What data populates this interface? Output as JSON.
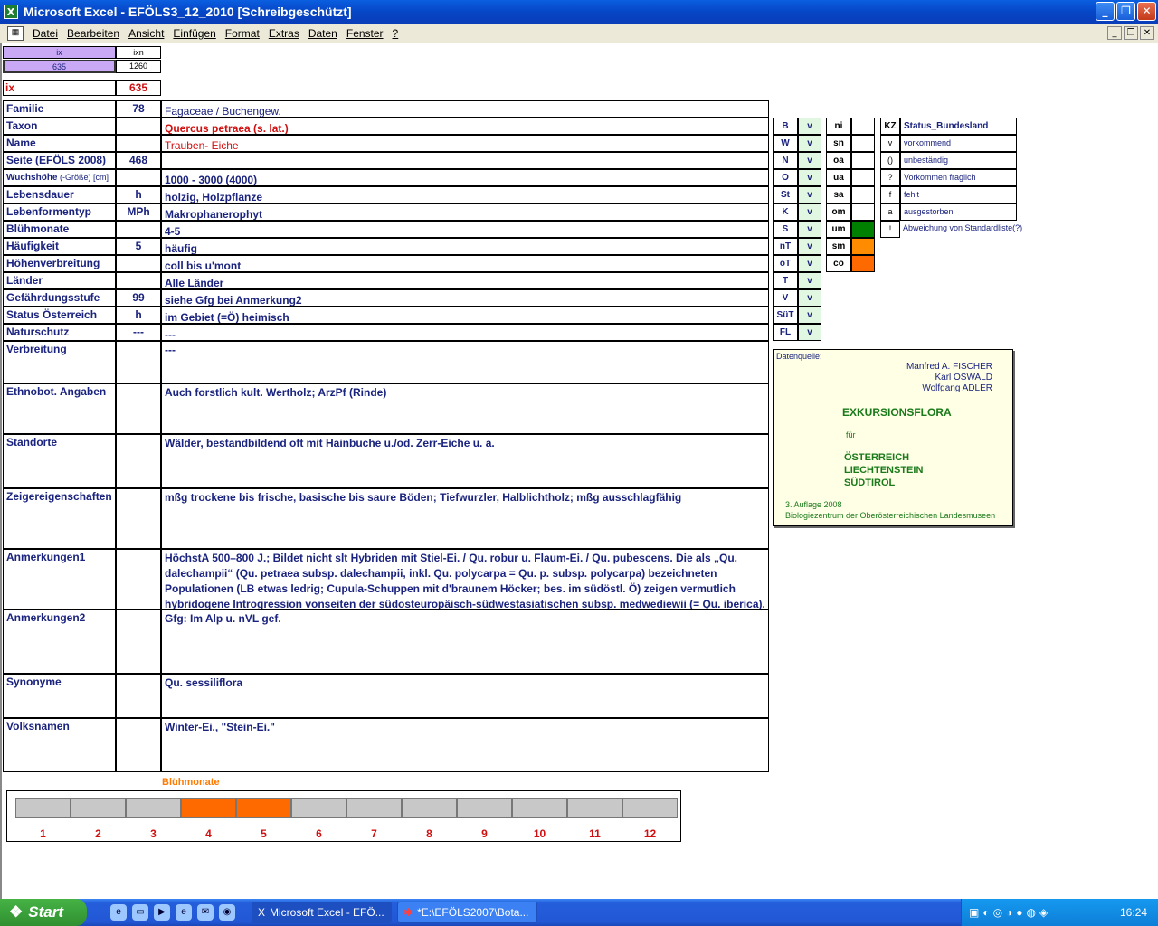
{
  "window": {
    "title": "Microsoft Excel - EFÖLS3_12_2010  [Schreibgeschützt]",
    "icon": "excel-icon"
  },
  "menu": [
    "Datei",
    "Bearbeiten",
    "Ansicht",
    "Einfügen",
    "Format",
    "Extras",
    "Daten",
    "Fenster",
    "?"
  ],
  "top": {
    "ix_label": "ix",
    "ixn_label": "ixn",
    "ix_value": "635",
    "ixn_value": "1260",
    "ix_big_label": "ix",
    "ix_big_value": "635"
  },
  "rows": [
    {
      "label": "Familie",
      "num": "78",
      "text": "Fagaceae  /  Buchengew."
    },
    {
      "label": "Taxon",
      "num": "",
      "text": "Quercus petraea (s. lat.)"
    },
    {
      "label": "Name",
      "num": "",
      "text": "Trauben- Eiche"
    },
    {
      "label": "Seite (EFÖLS 2008)",
      "num": "468",
      "text": ""
    },
    {
      "label": "Wuchshöhe",
      "label_extra": "(-Größe) [cm]",
      "num": "",
      "text": "1000 - 3000 (4000)"
    },
    {
      "label": "Lebensdauer",
      "num": "h",
      "text": "holzig, Holzpflanze"
    },
    {
      "label": "Lebenformentyp",
      "num": "MPh",
      "text": "Makrophanerophyt"
    },
    {
      "label": "Blühmonate",
      "num": "",
      "text": "4-5"
    },
    {
      "label": "Häufigkeit",
      "num": "5",
      "text": "häufig"
    },
    {
      "label": "Höhenverbreitung",
      "num": "",
      "text": "coll bis u'mont"
    },
    {
      "label": "Länder",
      "num": "",
      "text": "Alle Länder"
    },
    {
      "label": "Gefährdungsstufe",
      "num": "99",
      "text": "siehe Gfg bei Anmerkung2"
    },
    {
      "label": "Status Österreich",
      "num": "h",
      "text": "im Gebiet (=Ö) heimisch"
    },
    {
      "label": "Naturschutz",
      "num": "---",
      "text": "---"
    }
  ],
  "big_rows": [
    {
      "label": "Verbreitung",
      "text": "---"
    },
    {
      "label": "Ethnobot. Angaben",
      "text": "Auch forstlich kult. Wertholz; ArzPf (Rinde)"
    },
    {
      "label": "Standorte",
      "text": "Wälder, bestandbildend oft mit Hainbuche u./od. Zerr-Eiche u. a."
    },
    {
      "label": "Zeigereigenschaften",
      "text": "mßg trockene bis frische, basische bis saure Böden; Tiefwurzler, Halblichtholz; mßg ausschlagfähig"
    },
    {
      "label": "Anmerkungen1",
      "text": "HöchstA 500–800 J.;  Bildet nicht slt Hybriden mit Stiel-Ei. / Qu. robur u. Flaum-Ei. / Qu. pubescens. Die als „Qu. dalechampii“ (Qu. petraea subsp. dalechampii, inkl. Qu. polycarpa = Qu. p. subsp. polycarpa) bezeichneten Populationen (LB etwas ledrig; Cupula-Schuppen mit d'braunem Höcker; bes. im südöstl. Ö) zeigen vermutlich hybridogene Introgression vonseiten der südosteuropäisch-südwestasiatischen subsp. medwediewii (= Qu. iberica)."
    },
    {
      "label": "Anmerkungen2",
      "text": "Gfg: Im Alp u. nVL gef."
    },
    {
      "label": "Synonyme",
      "text": "Qu. sessiliflora"
    },
    {
      "label": "Volksnamen",
      "text": "Winter-Ei., \"Stein-Ei.\""
    }
  ],
  "states": [
    {
      "code": "B",
      "v": "v"
    },
    {
      "code": "W",
      "v": "v"
    },
    {
      "code": "N",
      "v": "v"
    },
    {
      "code": "O",
      "v": "v"
    },
    {
      "code": "St",
      "v": "v"
    },
    {
      "code": "K",
      "v": "v"
    },
    {
      "code": "S",
      "v": "v"
    },
    {
      "code": "nT",
      "v": "v"
    },
    {
      "code": "oT",
      "v": "v"
    },
    {
      "code": "T",
      "v": "v"
    },
    {
      "code": "V",
      "v": "v"
    },
    {
      "code": "SüT",
      "v": "v"
    },
    {
      "code": "FL",
      "v": "v"
    }
  ],
  "zones": [
    {
      "code": "ni",
      "color": ""
    },
    {
      "code": "sn",
      "color": ""
    },
    {
      "code": "oa",
      "color": ""
    },
    {
      "code": "ua",
      "color": ""
    },
    {
      "code": "sa",
      "color": ""
    },
    {
      "code": "om",
      "color": ""
    },
    {
      "code": "um",
      "color": "#008000"
    },
    {
      "code": "sm",
      "color": "#ff8c00"
    },
    {
      "code": "co",
      "color": "#ff6a00"
    }
  ],
  "legend": {
    "kz_header": "KZ",
    "status_header": "Status_Bundesland",
    "items": [
      {
        "kz": "v",
        "text": "vorkommend"
      },
      {
        "kz": "()",
        "text": "unbeständig"
      },
      {
        "kz": "?",
        "text": "Vorkommen fraglich"
      },
      {
        "kz": "f",
        "text": "fehlt"
      },
      {
        "kz": "a",
        "text": "ausgestorben"
      },
      {
        "kz": "!",
        "text": "Abweichung von Standardliste(?)"
      }
    ]
  },
  "source": {
    "label": "Datenquelle:",
    "authors": [
      "Manfred A. FISCHER",
      "Karl OSWALD",
      "Wolfgang ADLER"
    ],
    "title": "EXKURSIONSFLORA",
    "fuer": "für",
    "regions": [
      "ÖSTERREICH",
      "LIECHTENSTEIN",
      "SÜDTIROL"
    ],
    "edition": "3. Auflage 2008",
    "publisher": "Biologiezentrum der Oberösterreichischen Landesmuseen"
  },
  "bloom": {
    "title": "Blühmonate",
    "months": [
      "1",
      "2",
      "3",
      "4",
      "5",
      "6",
      "7",
      "8",
      "9",
      "10",
      "11",
      "12"
    ],
    "active": [
      4,
      5
    ],
    "active_color": "#ff6a00",
    "inactive_color": "#c8c8c8"
  },
  "taskbar": {
    "start": "Start",
    "tasks": [
      "Microsoft Excel - EFÖ...",
      "*E:\\EFÖLS2007\\Bota..."
    ],
    "clock": "16:24"
  }
}
